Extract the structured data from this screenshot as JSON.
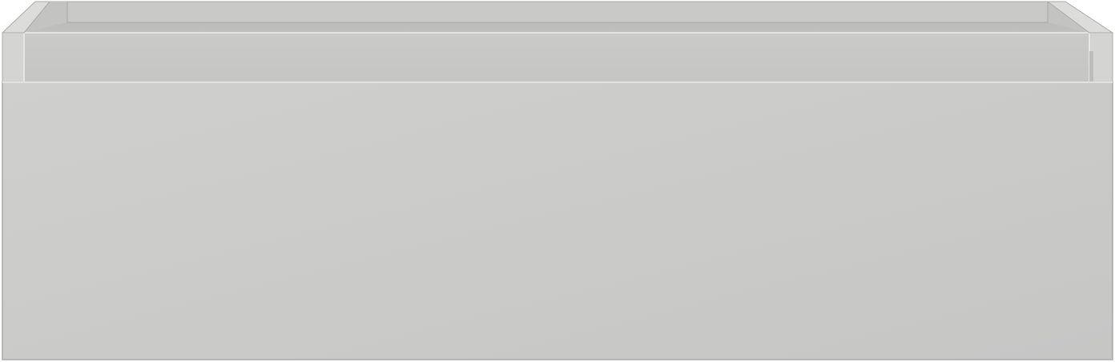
{
  "object": {
    "name": "drawer-box",
    "colors": {
      "front_panel": "#c9c9c8",
      "front_panel_light": "#cfcfcd",
      "inner_back_wall": "#bdbdbd",
      "inner_back_wall_dark": "#b4b4b4",
      "inner_side_wall": "#c6c6c4",
      "rim_edge": "#e2e2e0",
      "outline": "#a9a9a9",
      "side_face": "#d2d2d0",
      "background": "#ffffff"
    }
  }
}
